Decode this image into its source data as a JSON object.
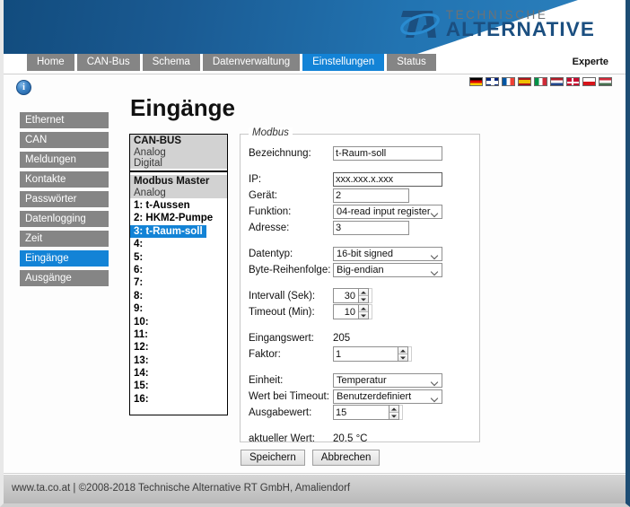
{
  "header": {
    "logo_line1": "TECHNISCHE",
    "logo_line2": "ALTERNATIVE",
    "logo_mark_alt": "ta-logo-icon"
  },
  "tabs": [
    {
      "label": "Home",
      "active": false
    },
    {
      "label": "CAN-Bus",
      "active": false
    },
    {
      "label": "Schema",
      "active": false
    },
    {
      "label": "Datenverwaltung",
      "active": false
    },
    {
      "label": "Einstellungen",
      "active": true
    },
    {
      "label": "Status",
      "active": false
    }
  ],
  "user_mode": "Experte",
  "languages": [
    {
      "name": "german-flag",
      "colors": [
        "#000000",
        "#dd0000",
        "#ffce00"
      ]
    },
    {
      "name": "uk-flag",
      "colors": [
        "#00247d",
        "#ffffff",
        "#cf142b"
      ]
    },
    {
      "name": "french-flag",
      "colors": [
        "#0055a4",
        "#ffffff",
        "#ef4135"
      ]
    },
    {
      "name": "spanish-flag",
      "colors": [
        "#aa151b",
        "#f1bf00",
        "#aa151b"
      ]
    },
    {
      "name": "italian-flag",
      "colors": [
        "#009246",
        "#ffffff",
        "#ce2b37"
      ]
    },
    {
      "name": "dutch-flag",
      "colors": [
        "#ae1c28",
        "#ffffff",
        "#21468b"
      ]
    },
    {
      "name": "danish-flag",
      "colors": [
        "#c60c30",
        "#ffffff",
        "#c60c30"
      ]
    },
    {
      "name": "czech-flag",
      "colors": [
        "#ffffff",
        "#d7141a",
        "#11457e"
      ]
    },
    {
      "name": "hungarian-flag",
      "colors": [
        "#ce2939",
        "#ffffff",
        "#477050"
      ]
    }
  ],
  "sidebar": {
    "items": [
      {
        "label": "Ethernet",
        "active": false
      },
      {
        "label": "CAN",
        "active": false
      },
      {
        "label": "Meldungen",
        "active": false
      },
      {
        "label": "Kontakte",
        "active": false
      },
      {
        "label": "Passwörter",
        "active": false
      },
      {
        "label": "Datenlogging",
        "active": false
      },
      {
        "label": "Zeit",
        "active": false
      },
      {
        "label": "Eingänge",
        "active": true
      },
      {
        "label": "Ausgänge",
        "active": false
      }
    ]
  },
  "page_title": "Eingänge",
  "listbox": {
    "group1_title": "CAN-BUS",
    "group1_subs": [
      "Analog",
      "Digital"
    ],
    "group2_title": "Modbus Master",
    "group2_sub": "Analog",
    "entries": [
      {
        "label": "1: t-Aussen",
        "selected": false
      },
      {
        "label": "2: HKM2-Pumpe",
        "selected": false
      },
      {
        "label": "3: t-Raum-soll",
        "selected": true
      },
      {
        "label": "4:",
        "selected": false
      },
      {
        "label": "5:",
        "selected": false
      },
      {
        "label": "6:",
        "selected": false
      },
      {
        "label": "7:",
        "selected": false
      },
      {
        "label": "8:",
        "selected": false
      },
      {
        "label": "9:",
        "selected": false
      },
      {
        "label": "10:",
        "selected": false
      },
      {
        "label": "11:",
        "selected": false
      },
      {
        "label": "12:",
        "selected": false
      },
      {
        "label": "13:",
        "selected": false
      },
      {
        "label": "14:",
        "selected": false
      },
      {
        "label": "15:",
        "selected": false
      },
      {
        "label": "16:",
        "selected": false
      }
    ]
  },
  "form": {
    "legend": "Modbus",
    "bezeichnung_label": "Bezeichnung:",
    "bezeichnung_value": "t-Raum-soll",
    "ip_label": "IP:",
    "ip_value": "xxx.xxx.x.xxx",
    "geraet_label": "Gerät:",
    "geraet_value": "2",
    "funktion_label": "Funktion:",
    "funktion_value": "04-read input register",
    "adresse_label": "Adresse:",
    "adresse_value": "3",
    "datentyp_label": "Datentyp:",
    "datentyp_value": "16-bit signed",
    "byte_label": "Byte-Reihenfolge:",
    "byte_value": "Big-endian",
    "intervall_label": "Intervall (Sek):",
    "intervall_value": "30",
    "timeout_label": "Timeout (Min):",
    "timeout_value": "10",
    "eingangswert_label": "Eingangswert:",
    "eingangswert_value": "205",
    "faktor_label": "Faktor:",
    "faktor_value": "1",
    "einheit_label": "Einheit:",
    "einheit_value": "Temperatur",
    "wert_timeout_label": "Wert bei Timeout:",
    "wert_timeout_value": "Benutzerdefiniert",
    "ausgabewert_label": "Ausgabewert:",
    "ausgabewert_value": "15",
    "aktueller_label": "aktueller Wert:",
    "aktueller_value": "20.5 °C"
  },
  "buttons": {
    "save": "Speichern",
    "cancel": "Abbrechen"
  },
  "footer": {
    "text": "www.ta.co.at | ©2008-2018 Technische Alternative RT GmbH, Amaliendorf"
  }
}
